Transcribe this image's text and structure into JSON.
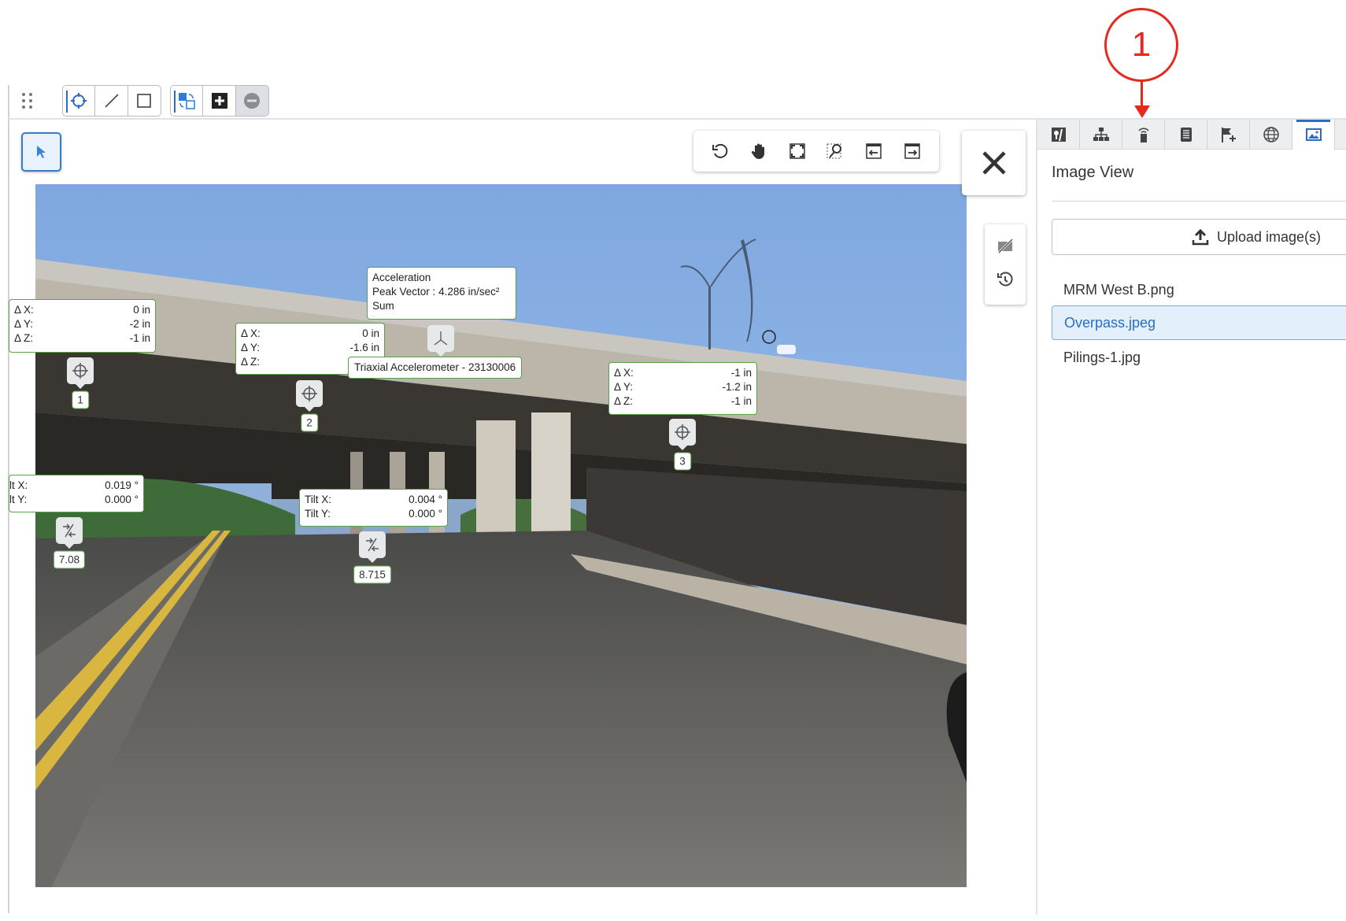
{
  "toolbar": {
    "drag_handle": "drag-handle-icon",
    "draw_tools": [
      "point-target-icon",
      "line-icon",
      "rectangle-icon"
    ],
    "edit_tools": [
      "swap-shape-icon",
      "add-icon",
      "remove-icon"
    ]
  },
  "select_tool": "pointer-icon",
  "view_toolbar": [
    "rotate-reset-icon",
    "pan-hand-icon",
    "fit-screen-icon",
    "zoom-region-icon",
    "previous-image-icon",
    "next-image-icon"
  ],
  "side_tools": [
    "hide-annotations-icon",
    "history-icon"
  ],
  "callout": {
    "number": "1",
    "color": "#e8281e"
  },
  "panel": {
    "tabs": [
      {
        "icon": "map-marker-icon",
        "active": false
      },
      {
        "icon": "hierarchy-icon",
        "active": false
      },
      {
        "icon": "sensor-icon",
        "active": false
      },
      {
        "icon": "list-icon",
        "active": false
      },
      {
        "icon": "flag-add-icon",
        "active": false
      },
      {
        "icon": "globe-icon",
        "active": false
      },
      {
        "icon": "image-icon",
        "active": true
      }
    ],
    "title": "Image View",
    "upload_label": "Upload image(s)",
    "files": [
      "MRM West B.png",
      "Overpass.jpeg",
      "Pilings-1.jpg"
    ],
    "selected_file": "Overpass.jpeg"
  },
  "annotations": {
    "disp1": {
      "x_label": "Δ X:",
      "x": "0 in",
      "y_label": "Δ Y:",
      "y": "-2 in",
      "z_label": "Δ Z:",
      "z": "-1 in",
      "id": "1"
    },
    "disp2": {
      "x_label": "Δ X:",
      "x": "0 in",
      "y_label": "Δ Y:",
      "y": "-1.6 in",
      "z_label": "Δ Z:",
      "z": "",
      "id": "2"
    },
    "disp3": {
      "x_label": "Δ X:",
      "x": "-1 in",
      "y_label": "Δ Y:",
      "y": "-1.2 in",
      "z_label": "Δ Z:",
      "z": "-1 in",
      "id": "3"
    },
    "accel": {
      "title": "Acceleration",
      "peak_label": "Peak Vector :",
      "peak_value": "4.286 in/sec²",
      "mode": "Sum",
      "name": "Triaxial Accelerometer - 23130006"
    },
    "tilt1": {
      "x_label": "lt X:",
      "x": "0.019 °",
      "y_label": "lt Y:",
      "y": "0.000 °",
      "value": "7.08"
    },
    "tilt2": {
      "x_label": "Tilt X:",
      "x": "0.004 °",
      "y_label": "Tilt Y:",
      "y": "0.000 °",
      "value": "8.715"
    }
  },
  "colors": {
    "accent": "#2b6cc4",
    "annotation_border": "#5aa04a",
    "callout": "#e8281e"
  }
}
